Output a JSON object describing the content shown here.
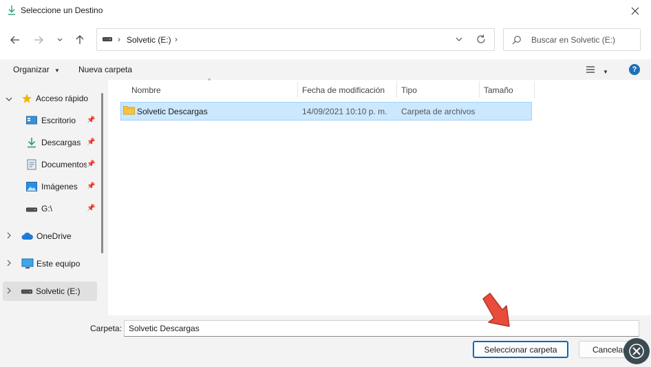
{
  "window": {
    "title": "Seleccione un Destino"
  },
  "address": {
    "drive_label": "Solvetic (E:)",
    "separator": "›",
    "search_placeholder": "Buscar en Solvetic (E:)"
  },
  "toolbar": {
    "organize_label": "Organizar",
    "new_folder_label": "Nueva carpeta",
    "help_label": "?"
  },
  "nav": {
    "quick_access": "Acceso rápido",
    "items": [
      {
        "label": "Escritorio",
        "icon": "desktop-icon"
      },
      {
        "label": "Descargas",
        "icon": "download-icon"
      },
      {
        "label": "Documentos",
        "icon": "document-icon"
      },
      {
        "label": "Imágenes",
        "icon": "pictures-icon"
      },
      {
        "label": "G:\\",
        "icon": "drive-icon"
      }
    ],
    "onedrive": "OneDrive",
    "this_pc": "Este equipo",
    "drive_e": "Solvetic (E:)"
  },
  "columns": {
    "name": "Nombre",
    "modified": "Fecha de modificación",
    "type": "Tipo",
    "size": "Tamaño"
  },
  "files": [
    {
      "name": "Solvetic Descargas",
      "modified": "14/09/2021 10:10 p. m.",
      "type": "Carpeta de archivos",
      "size": ""
    }
  ],
  "footer": {
    "folder_label": "Carpeta:",
    "folder_value": "Solvetic Descargas",
    "select_button": "Seleccionar carpeta",
    "cancel_button": "Cancelar"
  },
  "colors": {
    "accent": "#0067c0",
    "selection_bg": "#cce8ff",
    "selection_border": "#99d1ff",
    "folder_yellow": "#f5c542",
    "arrow_red": "#e74c3c"
  }
}
